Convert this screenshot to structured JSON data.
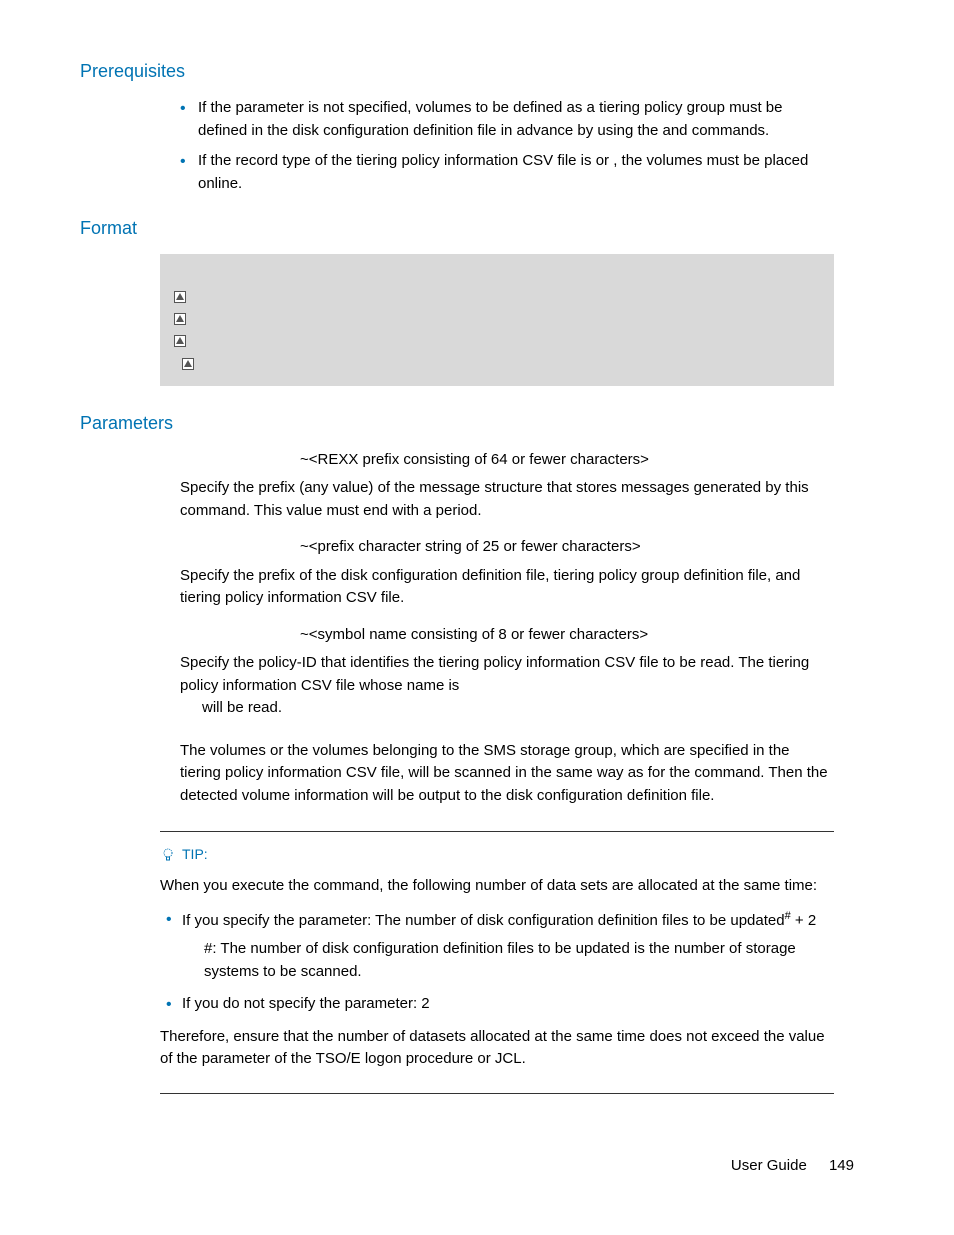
{
  "sections": {
    "prerequisites": {
      "title": "Prerequisites",
      "items": [
        {
          "text_a": "If the ",
          "text_b": " parameter is not specified, volumes to be defined as a tiering policy group must be defined in the disk configuration definition file in advance by using the ",
          "text_c": " and ",
          "text_d": " commands."
        },
        {
          "text_a": "If the record type of the tiering policy information CSV file is ",
          "text_b": " or ",
          "text_c": ", the volumes must be placed online."
        }
      ]
    },
    "format": {
      "title": "Format",
      "lines": [
        "",
        "",
        "",
        "",
        "",
        ""
      ]
    },
    "parameters": {
      "title": "Parameters",
      "items": [
        {
          "format": "~<REXX prefix consisting of 64 or fewer characters>",
          "desc": "Specify the prefix (any value) of the message structure that stores messages generated by this command. This value must end with a period."
        },
        {
          "format": "~<prefix character string of 25 or fewer characters>",
          "desc": "Specify the prefix of the disk configuration definition file, tiering policy group definition file, and tiering policy information CSV file."
        },
        {
          "format": "~<symbol name consisting of 8 or fewer characters>",
          "desc_a": "Specify the policy-ID that identifies the tiering policy information CSV file to be read. The tiering policy information CSV file whose name is ",
          "desc_b": " will be read."
        },
        {
          "desc_a": "The volumes or the volumes belonging to the SMS storage group, which are specified in the tiering policy information CSV file, will be scanned in the same way as for the ",
          "desc_b": " command. Then the detected volume information will be output to the disk configuration definition file."
        }
      ]
    },
    "tip": {
      "label": "TIP:",
      "intro_a": "When you execute the ",
      "intro_b": " command, the following number of data sets are allocated at the same time:",
      "items": [
        {
          "text_a": "If you specify the ",
          "text_b": " parameter: The number of disk configuration definition files to be updated",
          "text_c": " + 2",
          "hash_note": "#: The number of disk configuration definition files to be updated is the number of storage systems to be scanned."
        },
        {
          "text_a": "If you do not specify the ",
          "text_b": " parameter: 2"
        }
      ],
      "outro_a": "Therefore, ensure that the number of datasets allocated at the same time does not exceed the value of the ",
      "outro_b": " parameter of the TSO/E logon procedure or JCL."
    }
  },
  "footer": {
    "label": "User Guide",
    "page": "149"
  }
}
